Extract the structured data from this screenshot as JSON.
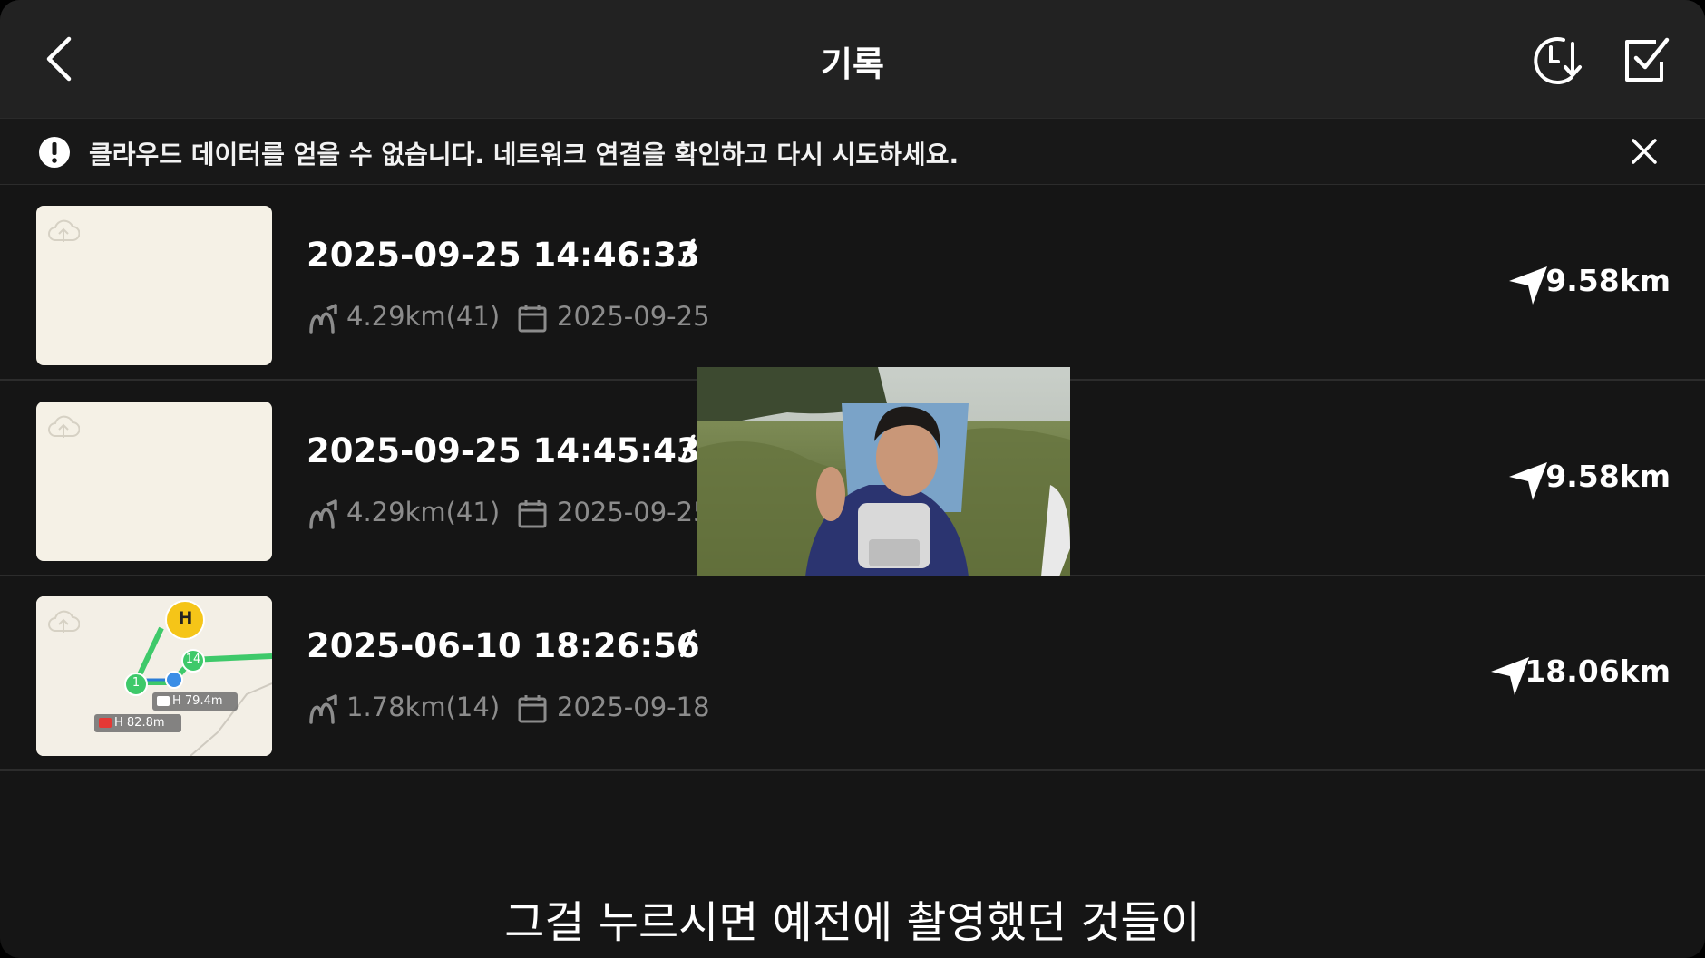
{
  "header": {
    "title": "기록"
  },
  "banner": {
    "message": "클라우드 데이터를 얻을 수 없습니다. 네트워크 연결을 확인하고 다시 시도하세요."
  },
  "records": [
    {
      "title": "2025-09-25 14:46:33",
      "route": "4.29km(41)",
      "date": "2025-09-25",
      "distance": "9.58km",
      "has_map": false
    },
    {
      "title": "2025-09-25 14:45:43",
      "route": "4.29km(41)",
      "date": "2025-09-25",
      "distance": "9.58km",
      "has_map": false
    },
    {
      "title": "2025-06-10 18:26:56",
      "route": "1.78km(14)",
      "date": "2025-09-18",
      "distance": "18.06km",
      "has_map": true,
      "map": {
        "home_label": "H",
        "waypoint_start": "1",
        "waypoint_end": "14",
        "camera_height": "H 79.4m",
        "record_height": "H 82.8m"
      }
    }
  ],
  "caption": "그걸 누르시면 예전에 촬영했던 것들이",
  "colors": {
    "background": "#151515",
    "header": "#222222",
    "thumbnail": "#f5f1e6",
    "route_green": "#3ec96a",
    "home_marker": "#f5c518",
    "meta_text": "#8c8c8c"
  }
}
